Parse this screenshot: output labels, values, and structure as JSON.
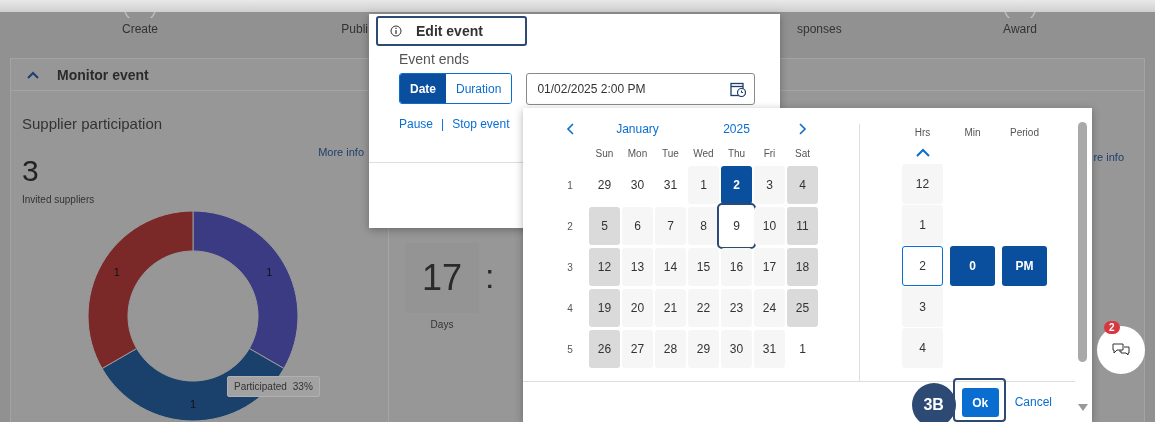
{
  "background": {
    "steps": [
      {
        "label": "Create"
      },
      {
        "label": "Publi"
      },
      {
        "label": "sponses"
      },
      {
        "label": "Award"
      }
    ],
    "monitor": {
      "title": "Monitor event",
      "expanded": true
    },
    "participation": {
      "title": "Supplier participation",
      "more_info": "More info",
      "count": "3",
      "count_label": "Invited suppliers",
      "chart_data": {
        "type": "donut",
        "values": [
          1,
          1,
          1
        ],
        "colors": [
          "#3b3b84",
          "#1a416b",
          "#7a2828"
        ],
        "data_labels": true
      },
      "tooltip": {
        "label": "Participated",
        "value": "33%"
      }
    },
    "countdown": {
      "more_info": "re info",
      "days_value": "17",
      "separator": ":",
      "days_label": "Days"
    }
  },
  "dialog": {
    "title": "Edit event",
    "section_label": "Event ends",
    "modes": [
      {
        "label": "Date",
        "selected": true
      },
      {
        "label": "Duration",
        "selected": false
      }
    ],
    "end_value": "01/02/2025 2:00 PM",
    "links": [
      "Pause",
      "Stop event"
    ],
    "link_separator": "|"
  },
  "picker": {
    "month": "January",
    "year": "2025",
    "weekdays": [
      "Sun",
      "Mon",
      "Tue",
      "Wed",
      "Thu",
      "Fri",
      "Sat"
    ],
    "weeks": [
      {
        "number": "1",
        "days": [
          {
            "label": "29",
            "kind": "other",
            "selected": false,
            "focused": false
          },
          {
            "label": "30",
            "kind": "other",
            "selected": false,
            "focused": false
          },
          {
            "label": "31",
            "kind": "other",
            "selected": false,
            "focused": false
          },
          {
            "label": "1",
            "kind": "weekday",
            "selected": false,
            "focused": false
          },
          {
            "label": "2",
            "kind": "weekday",
            "selected": true,
            "focused": false
          },
          {
            "label": "3",
            "kind": "weekday",
            "selected": false,
            "focused": false
          },
          {
            "label": "4",
            "kind": "weekend",
            "selected": false,
            "focused": false
          }
        ]
      },
      {
        "number": "2",
        "days": [
          {
            "label": "5",
            "kind": "weekend",
            "selected": false,
            "focused": false
          },
          {
            "label": "6",
            "kind": "weekday",
            "selected": false,
            "focused": false
          },
          {
            "label": "7",
            "kind": "weekday",
            "selected": false,
            "focused": false
          },
          {
            "label": "8",
            "kind": "weekday",
            "selected": false,
            "focused": false
          },
          {
            "label": "9",
            "kind": "weekday",
            "selected": false,
            "focused": true
          },
          {
            "label": "10",
            "kind": "weekday",
            "selected": false,
            "focused": false
          },
          {
            "label": "11",
            "kind": "weekend",
            "selected": false,
            "focused": false
          }
        ]
      },
      {
        "number": "3",
        "days": [
          {
            "label": "12",
            "kind": "weekend",
            "selected": false,
            "focused": false
          },
          {
            "label": "13",
            "kind": "weekday",
            "selected": false,
            "focused": false
          },
          {
            "label": "14",
            "kind": "weekday",
            "selected": false,
            "focused": false
          },
          {
            "label": "15",
            "kind": "weekday",
            "selected": false,
            "focused": false
          },
          {
            "label": "16",
            "kind": "weekday",
            "selected": false,
            "focused": false
          },
          {
            "label": "17",
            "kind": "weekday",
            "selected": false,
            "focused": false
          },
          {
            "label": "18",
            "kind": "weekend",
            "selected": false,
            "focused": false
          }
        ]
      },
      {
        "number": "4",
        "days": [
          {
            "label": "19",
            "kind": "weekend",
            "selected": false,
            "focused": false
          },
          {
            "label": "20",
            "kind": "weekday",
            "selected": false,
            "focused": false
          },
          {
            "label": "21",
            "kind": "weekday",
            "selected": false,
            "focused": false
          },
          {
            "label": "22",
            "kind": "weekday",
            "selected": false,
            "focused": false
          },
          {
            "label": "23",
            "kind": "weekday",
            "selected": false,
            "focused": false
          },
          {
            "label": "24",
            "kind": "weekday",
            "selected": false,
            "focused": false
          },
          {
            "label": "25",
            "kind": "weekend",
            "selected": false,
            "focused": false
          }
        ]
      },
      {
        "number": "5",
        "days": [
          {
            "label": "26",
            "kind": "weekend",
            "selected": false,
            "focused": false
          },
          {
            "label": "27",
            "kind": "weekday",
            "selected": false,
            "focused": false
          },
          {
            "label": "28",
            "kind": "weekday",
            "selected": false,
            "focused": false
          },
          {
            "label": "29",
            "kind": "weekday",
            "selected": false,
            "focused": false
          },
          {
            "label": "30",
            "kind": "weekday",
            "selected": false,
            "focused": false
          },
          {
            "label": "31",
            "kind": "weekday",
            "selected": false,
            "focused": false
          },
          {
            "label": "1",
            "kind": "other",
            "selected": false,
            "focused": false
          }
        ]
      }
    ],
    "time": {
      "headers": [
        "Hrs",
        "Min",
        "Period"
      ],
      "hours": [
        {
          "label": "12",
          "selected": false
        },
        {
          "label": "1",
          "selected": false
        },
        {
          "label": "2",
          "selected": true
        },
        {
          "label": "3",
          "selected": false
        },
        {
          "label": "4",
          "selected": false
        }
      ],
      "minutes": [
        {
          "label": "0",
          "selected": true
        }
      ],
      "periods": [
        {
          "label": "PM",
          "selected": true
        }
      ]
    },
    "step_badge": "3B",
    "ok": "Ok",
    "cancel": "Cancel"
  },
  "chat": {
    "badge": "2"
  }
}
